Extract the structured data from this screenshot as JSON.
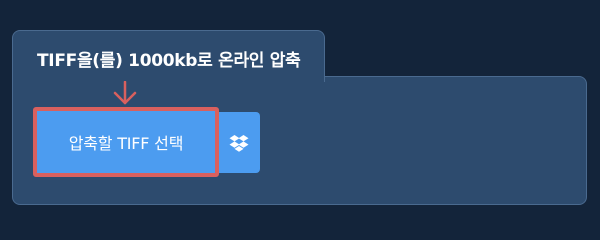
{
  "tab": {
    "title": "TIFF을(를) 1000kb로 온라인 압축"
  },
  "actions": {
    "select_label": "압축할 TIFF 선택",
    "dropbox_icon": "dropbox-icon"
  },
  "colors": {
    "background": "#13243a",
    "panel": "#2d4b6e",
    "button": "#4c9cf0",
    "highlight": "#d9605e"
  }
}
